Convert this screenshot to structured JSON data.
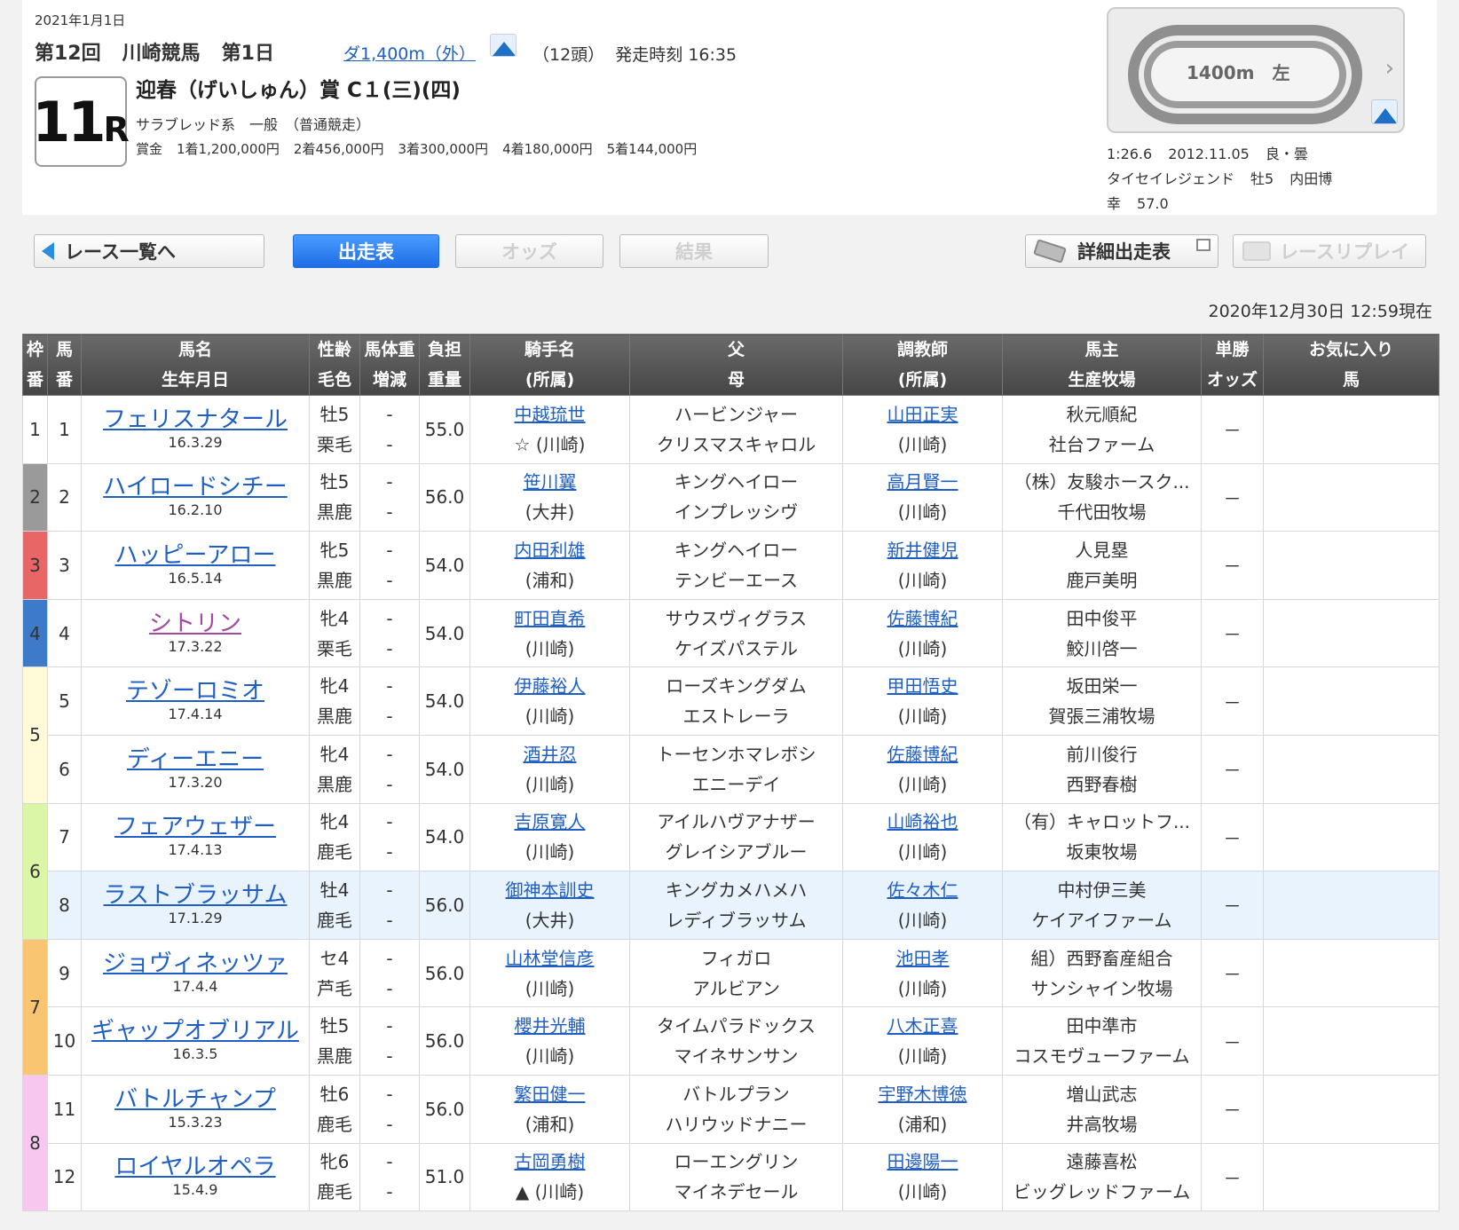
{
  "header": {
    "date": "2021年1月1日",
    "meeting": "第12回",
    "venue": "川崎競馬",
    "day": "第1日",
    "course": "ダ1,400m（外）",
    "field_count": "（12頭）",
    "post_time": "発走時刻 16:35",
    "race_number": "11",
    "race_suffix": "R",
    "race_name": "迎春（げいしゅん）賞 C１(三)(四)",
    "race_class": "サラブレッド系　一般　（普通競走）",
    "prize_label": "賞金",
    "prizes": [
      "1着1,200,000円",
      "2着456,000円",
      "3着300,000円",
      "4着180,000円",
      "5着144,000円"
    ]
  },
  "track": {
    "label": "1400m　左",
    "record": {
      "time": "1:26.6",
      "date": "2012.11.05",
      "condition": "良・曇",
      "horse": "タイセイレジェンド",
      "sex_age": "牡5",
      "jockey": "内田博",
      "jockey_rest": "幸",
      "weight": "57.0"
    }
  },
  "nav": {
    "back": "レース一覧へ",
    "entry": "出走表",
    "odds": "オッズ",
    "result": "結果",
    "detail": "詳細出走表",
    "replay": "レースリプレイ"
  },
  "timestamp": "2020年12月30日 12:59現在",
  "table": {
    "headers": {
      "waku": [
        "枠",
        "番"
      ],
      "uma": [
        "馬",
        "番"
      ],
      "horse": [
        "馬名",
        "生年月日"
      ],
      "sex": [
        "性齢",
        "毛色"
      ],
      "body": [
        "馬体重",
        "増減"
      ],
      "load": [
        "負担",
        "重量"
      ],
      "jockey": [
        "騎手名",
        "(所属)"
      ],
      "sire": [
        "父",
        "母"
      ],
      "trainer": [
        "調教師",
        "(所属)"
      ],
      "owner": [
        "馬主",
        "生産牧場"
      ],
      "odds": [
        "単勝",
        "オッズ"
      ],
      "fav": [
        "お気に入り",
        "馬"
      ]
    },
    "rows": [
      {
        "num": "1",
        "name": "フェリスナタール",
        "birth": "16.3.29",
        "sex": "牡5",
        "color": "栗毛",
        "weight": "-",
        "diff": "-",
        "load": "55.0",
        "jockey": "中越琉世",
        "jockey_aff": "☆ (川崎)",
        "sire": "ハービンジャー",
        "dam": "クリスマスキャロル",
        "trainer": "山田正実",
        "trainer_aff": "(川崎)",
        "owner": "秋元順紀",
        "breeder": "社台ファーム",
        "odds": "－"
      },
      {
        "num": "2",
        "name": "ハイロードシチー",
        "birth": "16.2.10",
        "sex": "牡5",
        "color": "黒鹿",
        "weight": "-",
        "diff": "-",
        "load": "56.0",
        "jockey": "笹川翼",
        "jockey_aff": "(大井)",
        "sire": "キングヘイロー",
        "dam": "インプレッシヴ",
        "trainer": "高月賢一",
        "trainer_aff": "(川崎)",
        "owner": "（株）友駿ホースク...",
        "breeder": "千代田牧場",
        "odds": "－"
      },
      {
        "num": "3",
        "name": "ハッピーアロー",
        "birth": "16.5.14",
        "sex": "牝5",
        "color": "黒鹿",
        "weight": "-",
        "diff": "-",
        "load": "54.0",
        "jockey": "内田利雄",
        "jockey_aff": "(浦和)",
        "sire": "キングヘイロー",
        "dam": "テンビーエース",
        "trainer": "新井健児",
        "trainer_aff": "(川崎)",
        "owner": "人見塁",
        "breeder": "鹿戸美明",
        "odds": "－"
      },
      {
        "num": "4",
        "name": "シトリン",
        "birth": "17.3.22",
        "sex": "牝4",
        "color": "栗毛",
        "weight": "-",
        "diff": "-",
        "load": "54.0",
        "jockey": "町田直希",
        "jockey_aff": "(川崎)",
        "sire": "サウスヴィグラス",
        "dam": "ケイズパステル",
        "trainer": "佐藤博紀",
        "trainer_aff": "(川崎)",
        "owner": "田中俊平",
        "breeder": "鮫川啓一",
        "odds": "－"
      },
      {
        "num": "5",
        "name": "テゾーロミオ",
        "birth": "17.4.14",
        "sex": "牝4",
        "color": "黒鹿",
        "weight": "-",
        "diff": "-",
        "load": "54.0",
        "jockey": "伊藤裕人",
        "jockey_aff": "(川崎)",
        "sire": "ローズキングダム",
        "dam": "エストレーラ",
        "trainer": "甲田悟史",
        "trainer_aff": "(川崎)",
        "owner": "坂田栄一",
        "breeder": "賀張三浦牧場",
        "odds": "－"
      },
      {
        "num": "6",
        "name": "ディーエニー",
        "birth": "17.3.20",
        "sex": "牝4",
        "color": "黒鹿",
        "weight": "-",
        "diff": "-",
        "load": "54.0",
        "jockey": "酒井忍",
        "jockey_aff": "(川崎)",
        "sire": "トーセンホマレボシ",
        "dam": "エニーデイ",
        "trainer": "佐藤博紀",
        "trainer_aff": "(川崎)",
        "owner": "前川俊行",
        "breeder": "西野春樹",
        "odds": "－"
      },
      {
        "num": "7",
        "name": "フェアウェザー",
        "birth": "17.4.13",
        "sex": "牝4",
        "color": "鹿毛",
        "weight": "-",
        "diff": "-",
        "load": "54.0",
        "jockey": "吉原寛人",
        "jockey_aff": "(川崎)",
        "sire": "アイルハヴアナザー",
        "dam": "グレイシアブルー",
        "trainer": "山崎裕也",
        "trainer_aff": "(川崎)",
        "owner": "（有）キャロットフ...",
        "breeder": "坂東牧場",
        "odds": "－"
      },
      {
        "num": "8",
        "name": "ラストブラッサム",
        "birth": "17.1.29",
        "sex": "牡4",
        "color": "鹿毛",
        "weight": "-",
        "diff": "-",
        "load": "56.0",
        "jockey": "御神本訓史",
        "jockey_aff": "(大井)",
        "sire": "キングカメハメハ",
        "dam": "レディブラッサム",
        "trainer": "佐々木仁",
        "trainer_aff": "(川崎)",
        "owner": "中村伊三美",
        "breeder": "ケイアイファーム",
        "odds": "－"
      },
      {
        "num": "9",
        "name": "ジョヴィネッツァ",
        "birth": "17.4.4",
        "sex": "セ4",
        "color": "芦毛",
        "weight": "-",
        "diff": "-",
        "load": "56.0",
        "jockey": "山林堂信彦",
        "jockey_aff": "(川崎)",
        "sire": "フィガロ",
        "dam": "アルビアン",
        "trainer": "池田孝",
        "trainer_aff": "(川崎)",
        "owner": "組）西野畜産組合",
        "breeder": "サンシャイン牧場",
        "odds": "－"
      },
      {
        "num": "10",
        "name": "ギャップオブリアル",
        "birth": "16.3.5",
        "sex": "牡5",
        "color": "黒鹿",
        "weight": "-",
        "diff": "-",
        "load": "56.0",
        "jockey": "櫻井光輔",
        "jockey_aff": "(川崎)",
        "sire": "タイムパラドックス",
        "dam": "マイネサンサン",
        "trainer": "八木正喜",
        "trainer_aff": "(川崎)",
        "owner": "田中準市",
        "breeder": "コスモヴューファーム",
        "odds": "－"
      },
      {
        "num": "11",
        "name": "バトルチャンプ",
        "birth": "15.3.23",
        "sex": "牡6",
        "color": "鹿毛",
        "weight": "-",
        "diff": "-",
        "load": "56.0",
        "jockey": "繁田健一",
        "jockey_aff": "(浦和)",
        "sire": "バトルプラン",
        "dam": "ハリウッドナニー",
        "trainer": "宇野木博徳",
        "trainer_aff": "(浦和)",
        "owner": "増山武志",
        "breeder": "井高牧場",
        "odds": "－"
      },
      {
        "num": "12",
        "name": "ロイヤルオペラ",
        "birth": "15.4.9",
        "sex": "牝6",
        "color": "鹿毛",
        "weight": "-",
        "diff": "-",
        "load": "51.0",
        "jockey": "古岡勇樹",
        "jockey_aff": "▲ (川崎)",
        "sire": "ローエングリン",
        "dam": "マイネデセール",
        "trainer": "田邊陽一",
        "trainer_aff": "(川崎)",
        "owner": "遠藤喜松",
        "breeder": "ビッグレッドファーム",
        "odds": "－"
      }
    ],
    "waku": [
      "1",
      "2",
      "3",
      "4",
      "5",
      "6",
      "7",
      "8"
    ]
  },
  "colors": {
    "link": "#1f5fc4",
    "visited_link": "#a04aa0",
    "active_button": "#1e6de6",
    "header_bg": "#4a4a4a",
    "highlight_row": "#e9f3fd"
  },
  "icons": [
    "course-map-icon",
    "chevron-right-icon",
    "back-arrow-icon",
    "ticket-icon",
    "window-icon",
    "film-icon"
  ]
}
